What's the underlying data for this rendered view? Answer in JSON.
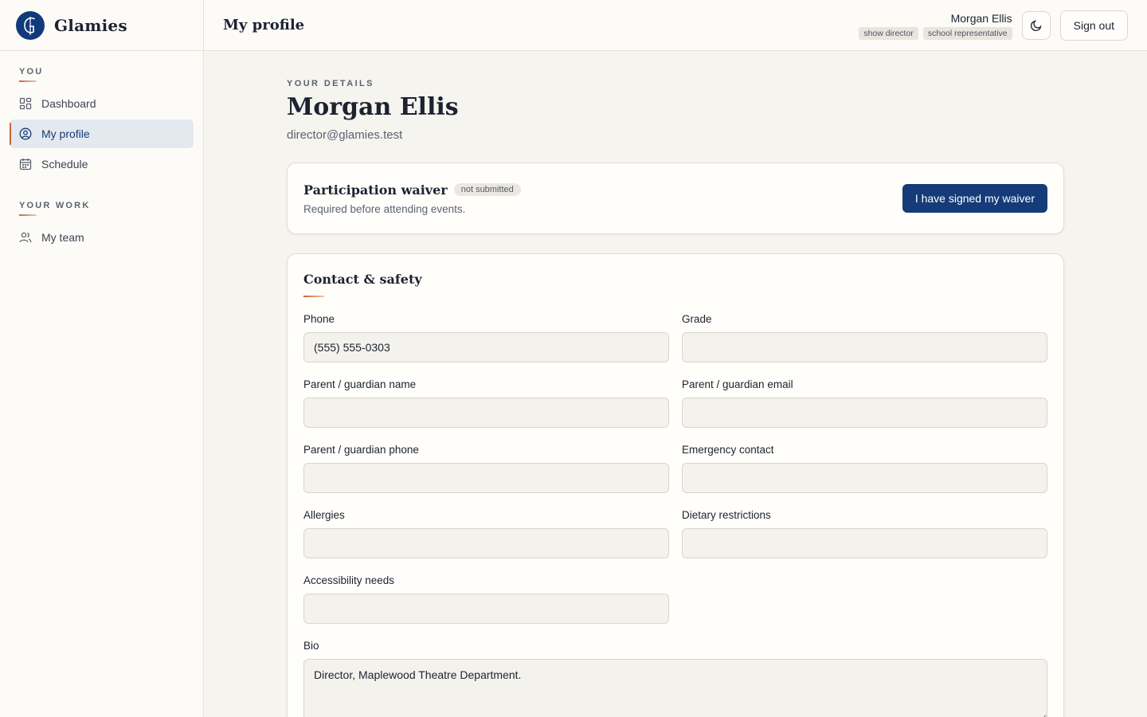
{
  "brand": {
    "name": "Glamies"
  },
  "sidebar": {
    "sections": [
      {
        "heading": "YOU"
      },
      {
        "heading": "YOUR WORK"
      }
    ],
    "items": [
      {
        "label": "Dashboard",
        "icon": "dashboard-icon"
      },
      {
        "label": "My profile",
        "icon": "user-circle-icon",
        "active": true
      },
      {
        "label": "Schedule",
        "icon": "calendar-icon"
      },
      {
        "label": "My team",
        "icon": "users-icon"
      }
    ]
  },
  "header": {
    "title": "My profile",
    "user_name": "Morgan Ellis",
    "roles": [
      "show director",
      "school representative"
    ],
    "theme_icon": "moon-icon",
    "sign_out_label": "Sign out"
  },
  "profile": {
    "eyebrow": "YOUR DETAILS",
    "name": "Morgan Ellis",
    "email": "director@glamies.test"
  },
  "waiver": {
    "title": "Participation waiver",
    "status": "not submitted",
    "description": "Required before attending events.",
    "action_label": "I have signed my waiver"
  },
  "contact": {
    "title": "Contact & safety",
    "fields": {
      "phone": {
        "label": "Phone",
        "value": "(555) 555-0303"
      },
      "grade": {
        "label": "Grade",
        "value": ""
      },
      "parent_name": {
        "label": "Parent / guardian name",
        "value": ""
      },
      "parent_email": {
        "label": "Parent / guardian email",
        "value": ""
      },
      "parent_phone": {
        "label": "Parent / guardian phone",
        "value": ""
      },
      "emergency_contact": {
        "label": "Emergency contact",
        "value": ""
      },
      "allergies": {
        "label": "Allergies",
        "value": ""
      },
      "dietary": {
        "label": "Dietary restrictions",
        "value": ""
      },
      "accessibility": {
        "label": "Accessibility needs",
        "value": ""
      },
      "bio": {
        "label": "Bio",
        "value": "Director, Maplewood Theatre Department."
      }
    }
  },
  "colors": {
    "primary": "#153c78",
    "accent": "#c8663a",
    "background": "#f6f4ef",
    "surface": "#fffefb"
  }
}
